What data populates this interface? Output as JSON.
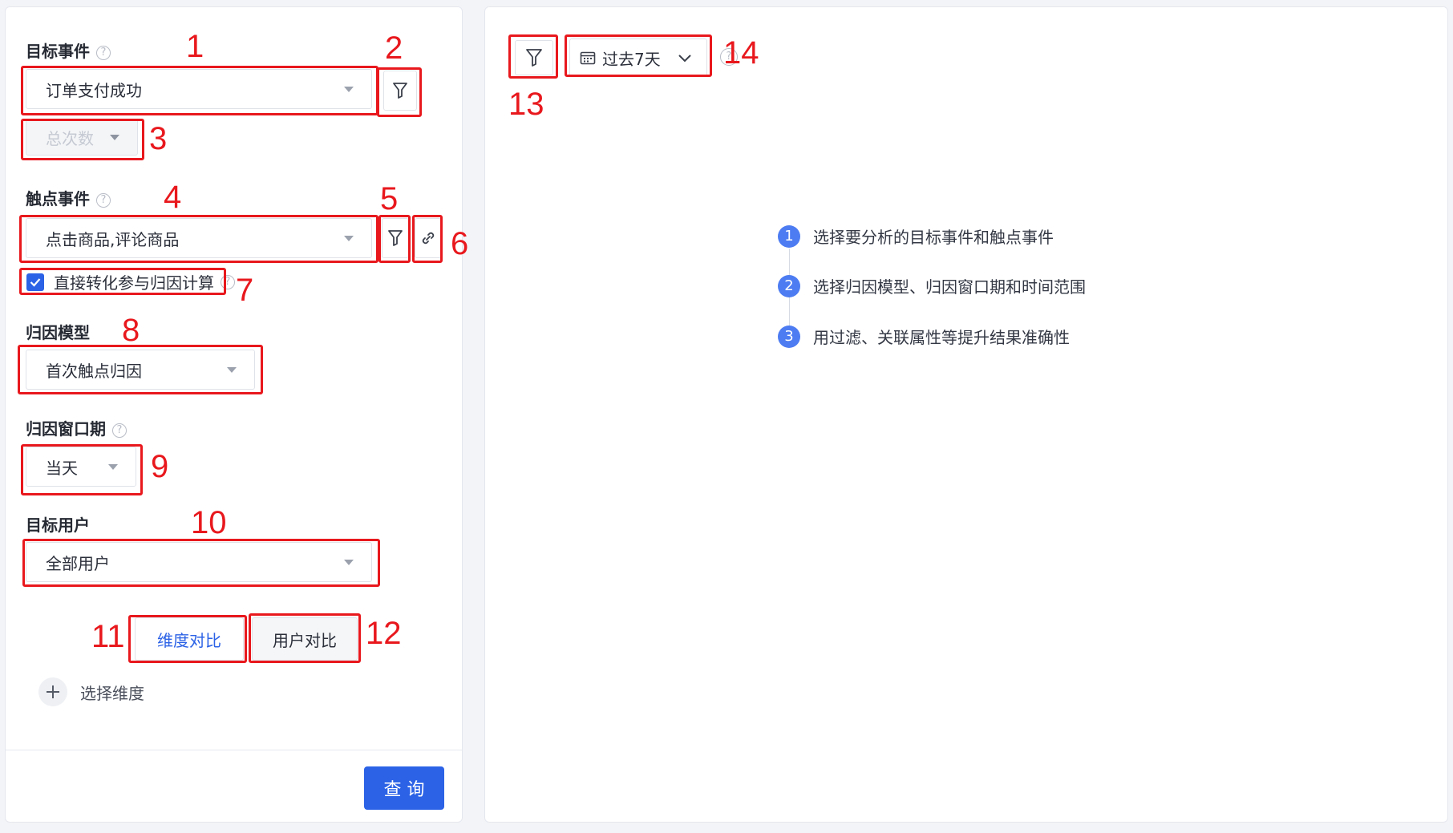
{
  "left": {
    "target_event": {
      "label": "目标事件",
      "value": "订单支付成功",
      "metric": "总次数"
    },
    "touch_event": {
      "label": "触点事件",
      "value": "点击商品,评论商品"
    },
    "direct_conversion": {
      "label": "直接转化参与归因计算",
      "checked": true
    },
    "attribution_model": {
      "label": "归因模型",
      "value": "首次触点归因"
    },
    "attribution_window": {
      "label": "归因窗口期",
      "value": "当天"
    },
    "target_user": {
      "label": "目标用户",
      "value": "全部用户"
    },
    "compare_tabs": [
      {
        "label": "维度对比",
        "active": true
      },
      {
        "label": "用户对比",
        "active": false
      }
    ],
    "add_dimension": {
      "label": "选择维度"
    },
    "query_button": {
      "label": "查 询"
    }
  },
  "right": {
    "date_range": "过去7天",
    "steps": [
      {
        "number": "1",
        "text": "选择要分析的目标事件和触点事件"
      },
      {
        "number": "2",
        "text": "选择归因模型、归因窗口期和时间范围"
      },
      {
        "number": "3",
        "text": "用过滤、关联属性等提升结果准确性"
      }
    ]
  },
  "annotations": [
    "1",
    "2",
    "3",
    "4",
    "5",
    "6",
    "7",
    "8",
    "9",
    "10",
    "11",
    "12",
    "13",
    "14"
  ],
  "colors": {
    "primary": "#2b62e6",
    "annotation_red": "#e8181d",
    "step_blue": "#4d7cf2"
  }
}
